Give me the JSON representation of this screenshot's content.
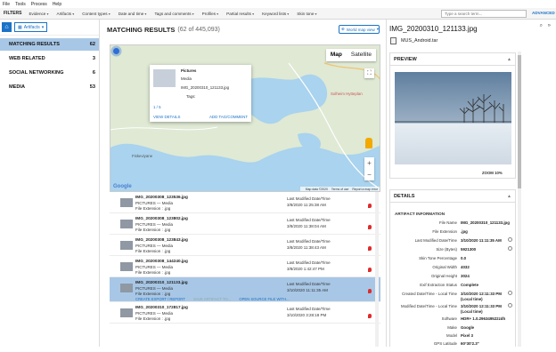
{
  "menu": [
    "File",
    "Tools",
    "Process",
    "Help"
  ],
  "filters": {
    "label": "FILTERS",
    "items": [
      "Evidence",
      "Artifacts",
      "Content types",
      "Date and time",
      "Tags and comments",
      "Profiles",
      "Partial results",
      "Keyword lists",
      "Skin tone"
    ],
    "search_placeholder": "Type a search term...",
    "advanced_label": "ADVANCED"
  },
  "left": {
    "artifacts_label": "Artifacts",
    "categories": [
      {
        "name": "MATCHING RESULTS",
        "count": "62"
      },
      {
        "name": "WEB RELATED",
        "count": "3"
      },
      {
        "name": "SOCIAL NETWORKING",
        "count": "6"
      },
      {
        "name": "MEDIA",
        "count": "53"
      }
    ]
  },
  "main": {
    "title": "MATCHING RESULTS",
    "count_text": "(62 of 445,093)",
    "map_view_label": "World map view"
  },
  "map": {
    "tabs": [
      "Map",
      "Satellite"
    ],
    "place_labels": [
      "Fiskeviyane",
      "Solheim Hytteplan"
    ],
    "brand": "Google",
    "footer": [
      "Map data ©2020",
      "Terms of use",
      "Report a map error"
    ],
    "popup": {
      "title": "Pictures",
      "media": "Media",
      "file": "IMG_20200310_121133.jpg",
      "tags": "Tags:",
      "page": "1 / 5",
      "view_details": "VIEW DETAILS",
      "add_tag": "ADD TAG/COMMENT"
    }
  },
  "rows": [
    {
      "name": "IMG_20200308_123536.jpg",
      "category": "PICTURES  —  Media",
      "ext": "File Extension :  .jpg",
      "modified_label": "Last Modified Date/Time",
      "modified": "3/8/2020  11:25:38 AM"
    },
    {
      "name": "IMG_20200308_123802.jpg",
      "category": "PICTURES  —  Media",
      "ext": "File Extension :  .jpg",
      "modified_label": "Last Modified Date/Time",
      "modified": "3/8/2020  11:38:04 AM"
    },
    {
      "name": "IMG_20200308_123843.jpg",
      "category": "PICTURES  —  Media",
      "ext": "File Extension :  .jpg",
      "modified_label": "Last Modified Date/Time",
      "modified": "3/8/2020  11:38:43 AM"
    },
    {
      "name": "IMG_20200308_144240.jpg",
      "category": "PICTURES  —  Media",
      "ext": "File Extension :  .jpg",
      "modified_label": "Last Modified Date/Time",
      "modified": "3/8/2020  1:42:47 PM"
    },
    {
      "name": "IMG_20200310_121133.jpg",
      "category": "PICTURES  —  Media",
      "ext": "File Extension :  .jpg",
      "modified_label": "Last Modified Date/Time",
      "modified": "3/10/2020  11:11:35 AM",
      "actions": [
        "CREATE EXPORT / REPORT",
        "SAVE ARTIFACT TO...",
        "OPEN SOURCE FILE WITH..."
      ]
    },
    {
      "name": "IMG_20200310_172817.jpg",
      "category": "PICTURES  —  Media",
      "ext": "File Extension :  .jpg",
      "modified_label": "Last Modified Date/Time",
      "modified": "3/10/2020  3:28:18 PM"
    }
  ],
  "right": {
    "title": "IMG_20200310_121133.jpg",
    "source_file": "MUS_Android.tar",
    "preview_header": "PREVIEW",
    "zoom_label": "ZOOM 10%",
    "details_header": "DETAILS",
    "artifact_info": "ARTIFACT INFORMATION",
    "details": [
      {
        "k": "File Name",
        "v": "IMG_20200310_121133.jpg"
      },
      {
        "k": "File Extension",
        "v": ".jpg"
      },
      {
        "k": "Last Modified Date/Time",
        "v": "3/10/2020 11:11:35 AM"
      },
      {
        "k": "Size (Bytes)",
        "v": "5921300"
      },
      {
        "k": "Skin Tone Percentage",
        "v": "0.0"
      },
      {
        "k": "Original Width",
        "v": "4032"
      },
      {
        "k": "Original Height",
        "v": "3024"
      },
      {
        "k": "Exif Extraction Status",
        "v": "Complete"
      },
      {
        "k": "Created Date/Time - Local Time",
        "v": "3/10/2020 12:11:33 PM",
        "v2": "(Local time)"
      },
      {
        "k": "Modified Date/Time - Local Time",
        "v": "3/10/2020 12:11:33 PM",
        "v2": "(Local time)"
      },
      {
        "k": "Software",
        "v": "HDR+ 1.0.296349522zdh"
      },
      {
        "k": "Make",
        "v": "Google"
      },
      {
        "k": "Model",
        "v": "Pixel 3"
      },
      {
        "k": "GPS Latitude",
        "v": "60°30'2.3\""
      }
    ]
  }
}
